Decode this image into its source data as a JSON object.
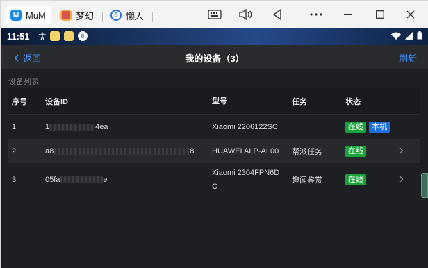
{
  "titlebar": {
    "tabs": [
      {
        "label": "MuM",
        "icon": "mumu-app-icon"
      },
      {
        "label": "梦幻",
        "icon": "game-app-icon"
      },
      {
        "label": "懒人",
        "icon": "lanren-app-icon"
      }
    ],
    "controls": [
      "keyboard-icon",
      "volume-icon",
      "back-triangle-icon",
      "more-icon",
      "minimize-icon",
      "maximize-icon",
      "close-icon"
    ]
  },
  "statusbar": {
    "time": "11:51"
  },
  "appbar": {
    "back_label": "返回",
    "title": "我的设备（3）",
    "refresh_label": "刷新"
  },
  "section_label": "设备列表",
  "table": {
    "headers": {
      "seq": "序号",
      "id": "设备ID",
      "model": "型号",
      "task": "任务",
      "status": "状态"
    },
    "rows": [
      {
        "seq": "1",
        "id_prefix": "1",
        "id_suffix": "4ea",
        "model": "Xiaomi 2206122SC",
        "task": "",
        "status": [
          "在线",
          "本机"
        ],
        "arrow": false
      },
      {
        "seq": "2",
        "id_prefix": "a8",
        "id_suffix": "8",
        "model": "HUAWEI ALP-AL00",
        "task": "帮派任务",
        "status": [
          "在线"
        ],
        "arrow": true
      },
      {
        "seq": "3",
        "id_prefix": "05fa",
        "id_suffix": "e",
        "model": "Xiaomi 2304FPN6DC",
        "task": "趣闻鉴赏",
        "status": [
          "在线"
        ],
        "arrow": true
      }
    ]
  },
  "colors": {
    "accent": "#3d8bf2",
    "online": "#1aa33a",
    "local": "#1f6fe0"
  }
}
